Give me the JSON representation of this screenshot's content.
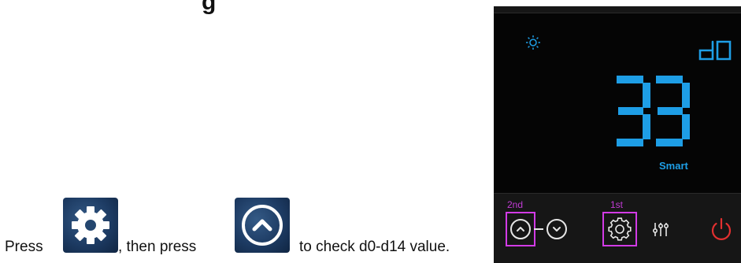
{
  "heading": {
    "text": "g"
  },
  "instruction": {
    "part1": "Press",
    "part2": ", then press",
    "part3": "to check d0-d14 value.",
    "button1_icon": "gear-icon",
    "button2_icon": "chevron-up-icon"
  },
  "display": {
    "sun_icon": "sun-icon",
    "parameter_code": "d0",
    "value": "33",
    "mode": "Smart",
    "digit_color": "#1e9ee6"
  },
  "controls": {
    "second_tag": "2nd",
    "first_tag": "1st",
    "highlight_color": "#d23be6",
    "up_icon": "chevron-up-icon",
    "down_icon": "chevron-down-icon",
    "settings_icon": "gear-icon",
    "sliders_icon": "sliders-icon",
    "power_icon": "power-icon",
    "power_color": "#e23030"
  }
}
